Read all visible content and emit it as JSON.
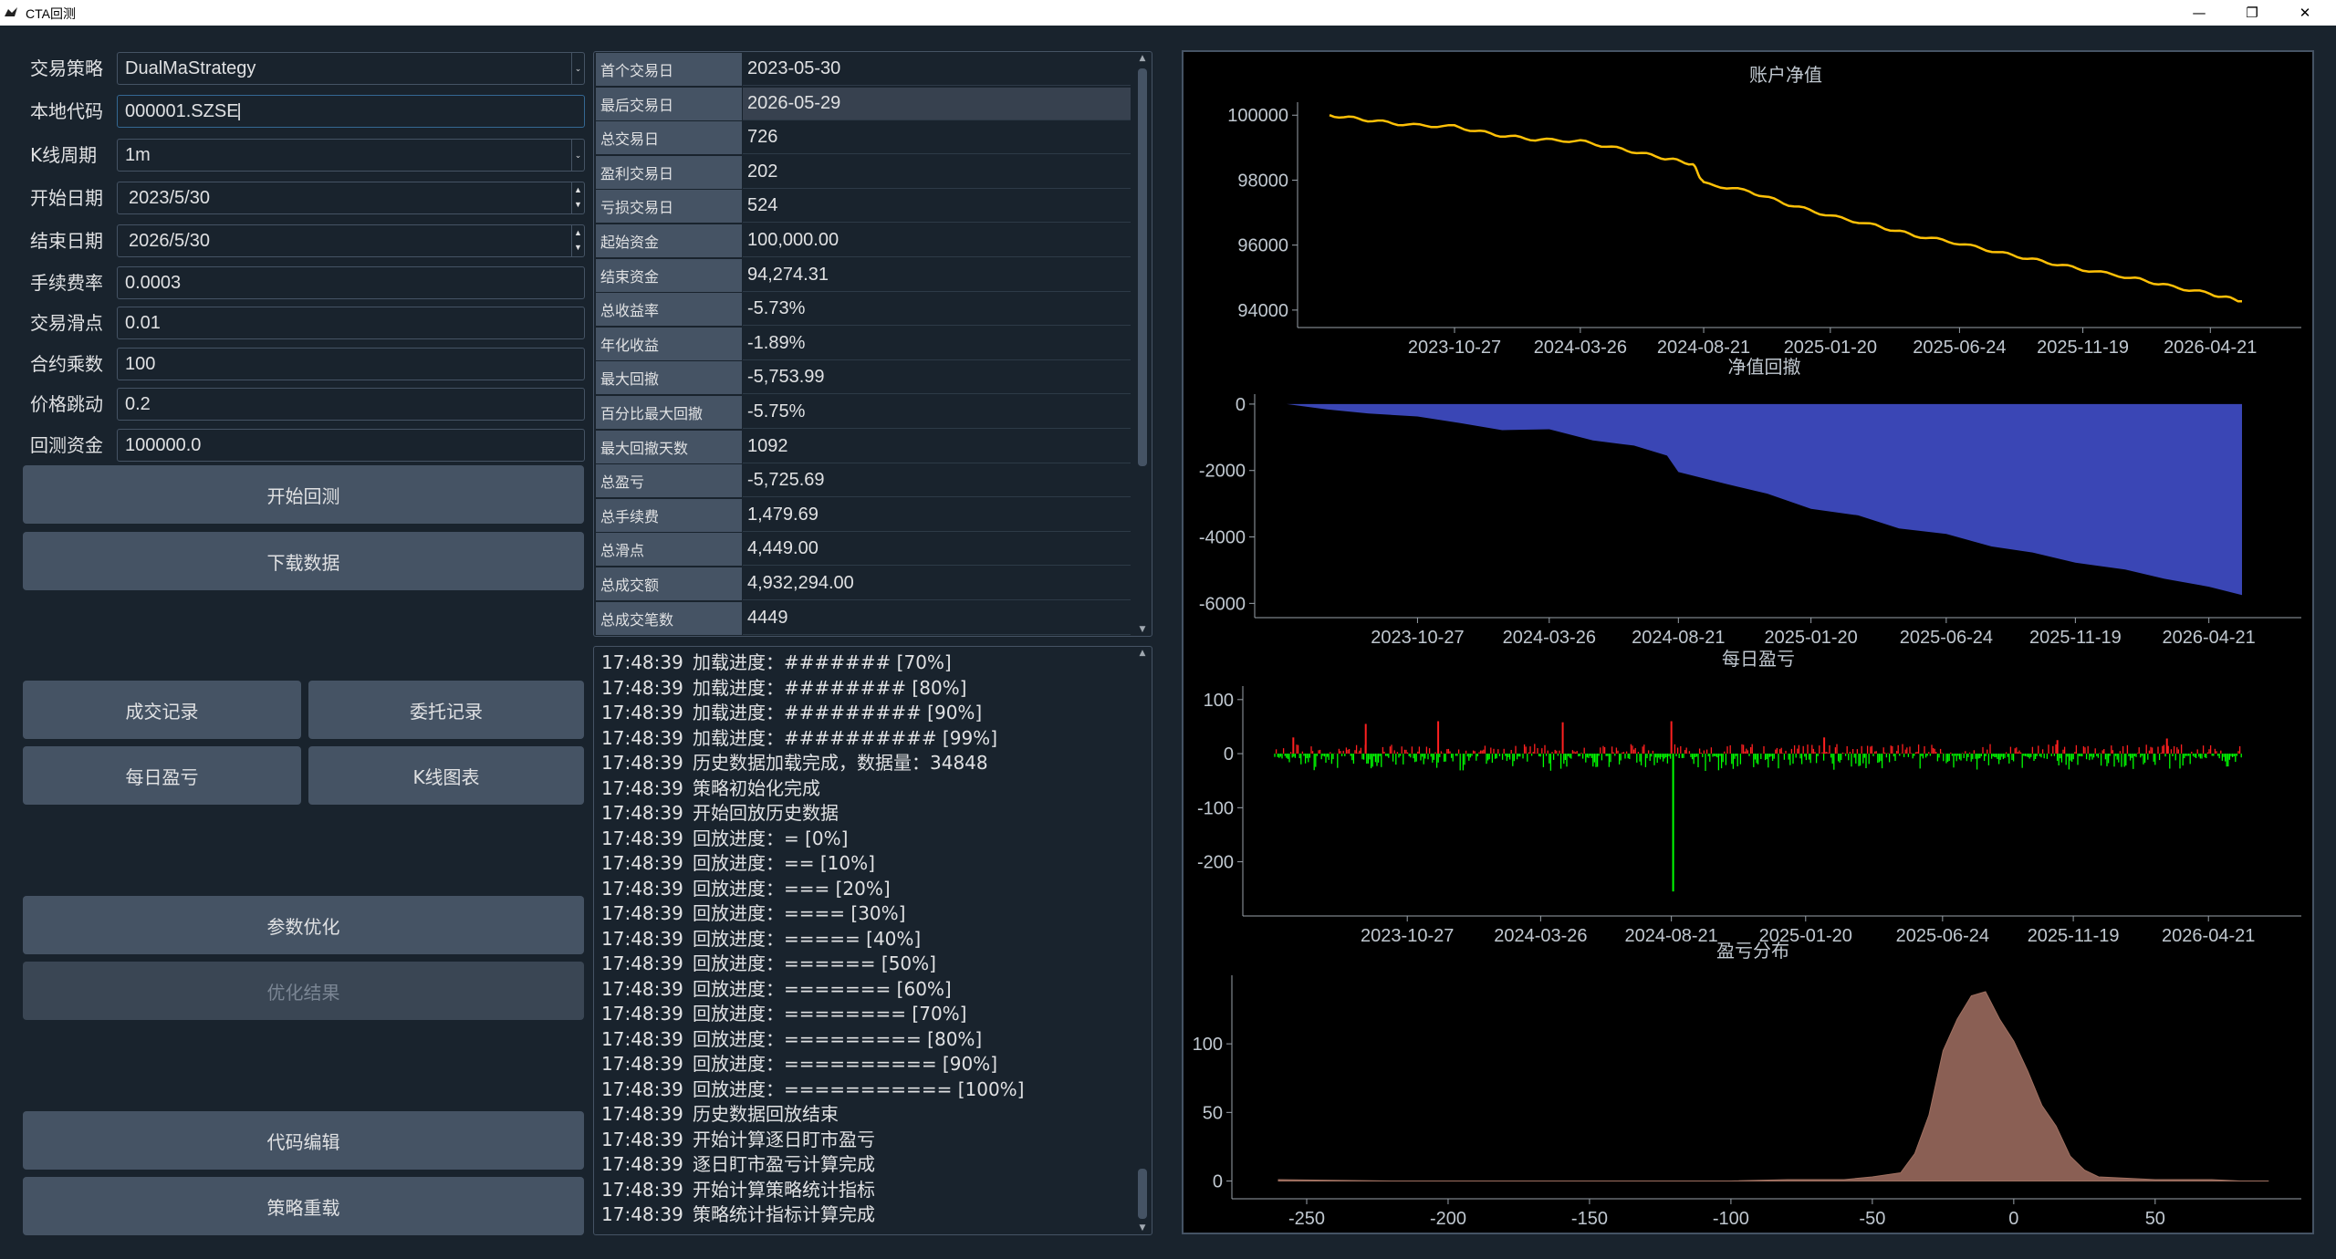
{
  "window": {
    "title": "CTA回测",
    "min": "—",
    "max": "❐",
    "close": "✕"
  },
  "form": [
    {
      "label": "交易策略",
      "value": "DualMaStrategy",
      "kind": "combo"
    },
    {
      "label": "本地代码",
      "value": "000001.SZSE",
      "kind": "text",
      "focus": true
    },
    {
      "label": "K线周期",
      "value": "1m",
      "kind": "combo"
    },
    {
      "label": "开始日期",
      "value": "2023/5/30",
      "kind": "date"
    },
    {
      "label": "结束日期",
      "value": "2026/5/30",
      "kind": "date"
    },
    {
      "label": "手续费率",
      "value": "0.0003",
      "kind": "text"
    },
    {
      "label": "交易滑点",
      "value": "0.01",
      "kind": "text"
    },
    {
      "label": "合约乘数",
      "value": "100",
      "kind": "text"
    },
    {
      "label": "价格跳动",
      "value": "0.2",
      "kind": "text"
    },
    {
      "label": "回测资金",
      "value": "100000.0",
      "kind": "text"
    }
  ],
  "buttons": {
    "start": "开始回测",
    "download": "下载数据",
    "trades": "成交记录",
    "orders": "委托记录",
    "daily": "每日盈亏",
    "kline": "K线图表",
    "optimize": "参数优化",
    "opt_result": "优化结果",
    "edit": "代码编辑",
    "reload": "策略重载"
  },
  "stats": [
    [
      "首个交易日",
      "2023-05-30"
    ],
    [
      "最后交易日",
      "2026-05-29"
    ],
    [
      "总交易日",
      "726"
    ],
    [
      "盈利交易日",
      "202"
    ],
    [
      "亏损交易日",
      "524"
    ],
    [
      "起始资金",
      "100,000.00"
    ],
    [
      "结束资金",
      "94,274.31"
    ],
    [
      "总收益率",
      "-5.73%"
    ],
    [
      "年化收益",
      "-1.89%"
    ],
    [
      "最大回撤",
      "-5,753.99"
    ],
    [
      "百分比最大回撤",
      "-5.75%"
    ],
    [
      "最大回撤天数",
      "1092"
    ],
    [
      "总盈亏",
      "-5,725.69"
    ],
    [
      "总手续费",
      "1,479.69"
    ],
    [
      "总滑点",
      "4,449.00"
    ],
    [
      "总成交额",
      "4,932,294.00"
    ],
    [
      "总成交笔数",
      "4449"
    ]
  ],
  "log": [
    [
      "17:48:39",
      "加载进度：####### [70%]"
    ],
    [
      "17:48:39",
      "加载进度：######## [80%]"
    ],
    [
      "17:48:39",
      "加载进度：######### [90%]"
    ],
    [
      "17:48:39",
      "加载进度：########## [99%]"
    ],
    [
      "17:48:39",
      "历史数据加载完成，数据量：34848"
    ],
    [
      "17:48:39",
      "策略初始化完成"
    ],
    [
      "17:48:39",
      "开始回放历史数据"
    ],
    [
      "17:48:39",
      "回放进度：= [0%]"
    ],
    [
      "17:48:39",
      "回放进度：== [10%]"
    ],
    [
      "17:48:39",
      "回放进度：=== [20%]"
    ],
    [
      "17:48:39",
      "回放进度：==== [30%]"
    ],
    [
      "17:48:39",
      "回放进度：===== [40%]"
    ],
    [
      "17:48:39",
      "回放进度：====== [50%]"
    ],
    [
      "17:48:39",
      "回放进度：======= [60%]"
    ],
    [
      "17:48:39",
      "回放进度：======== [70%]"
    ],
    [
      "17:48:39",
      "回放进度：========= [80%]"
    ],
    [
      "17:48:39",
      "回放进度：========== [90%]"
    ],
    [
      "17:48:39",
      "回放进度：=========== [100%]"
    ],
    [
      "17:48:39",
      "历史数据回放结束"
    ],
    [
      "17:48:39",
      "开始计算逐日盯市盈亏"
    ],
    [
      "17:48:39",
      "逐日盯市盈亏计算完成"
    ],
    [
      "17:48:39",
      "开始计算策略统计指标"
    ],
    [
      "17:48:39",
      "策略统计指标计算完成"
    ]
  ],
  "chart_data": [
    {
      "type": "line",
      "title": "账户净值",
      "color": "#ffc107",
      "x": [
        "2023-05-30",
        "2023-07-15",
        "2023-09-01",
        "2023-10-27",
        "2023-12-15",
        "2024-02-01",
        "2024-03-26",
        "2024-05-15",
        "2024-07-01",
        "2024-08-08",
        "2024-08-21",
        "2024-10-15",
        "2024-12-01",
        "2025-01-20",
        "2025-03-15",
        "2025-05-01",
        "2025-06-24",
        "2025-08-15",
        "2025-10-01",
        "2025-11-19",
        "2026-01-15",
        "2026-03-01",
        "2026-04-21",
        "2026-05-29"
      ],
      "y": [
        100000,
        99850,
        99700,
        99650,
        99400,
        99250,
        99200,
        98950,
        98700,
        98500,
        97900,
        97650,
        97250,
        96900,
        96600,
        96300,
        96050,
        95750,
        95500,
        95250,
        95000,
        94750,
        94500,
        94270
      ],
      "xticks": [
        "2023-10-27",
        "2024-03-26",
        "2024-08-21",
        "2025-01-20",
        "2025-06-24",
        "2025-11-19",
        "2026-04-21"
      ],
      "yticks": [
        94000,
        96000,
        98000,
        100000
      ],
      "ylim": [
        93800,
        100400
      ]
    },
    {
      "type": "area",
      "title": "净值回撤",
      "color": "#3a46b5",
      "x": [
        "2023-05-30",
        "2023-07-15",
        "2023-09-01",
        "2023-10-27",
        "2023-12-15",
        "2024-02-01",
        "2024-03-26",
        "2024-05-15",
        "2024-07-01",
        "2024-08-08",
        "2024-08-21",
        "2024-10-15",
        "2024-12-01",
        "2025-01-20",
        "2025-03-15",
        "2025-05-01",
        "2025-06-24",
        "2025-08-15",
        "2025-10-01",
        "2025-11-19",
        "2026-01-15",
        "2026-03-01",
        "2026-04-21",
        "2026-05-29"
      ],
      "y": [
        0,
        -150,
        -300,
        -350,
        -600,
        -750,
        -800,
        -1050,
        -1300,
        -1500,
        -2100,
        -2350,
        -2750,
        -3100,
        -3400,
        -3700,
        -3950,
        -4250,
        -4500,
        -4750,
        -5000,
        -5250,
        -5500,
        -5754
      ],
      "xticks": [
        "2023-10-27",
        "2024-03-26",
        "2024-08-21",
        "2025-01-20",
        "2025-06-24",
        "2025-11-19",
        "2026-04-21"
      ],
      "yticks": [
        -6000,
        -4000,
        -2000,
        0
      ],
      "ylim": [
        -6100,
        300
      ]
    },
    {
      "type": "bar",
      "title": "每日盈亏",
      "colors": {
        "profit": "#ff2020",
        "loss": "#00ff00"
      },
      "x": [
        "2023-06-20",
        "2023-09-10",
        "2023-12-01",
        "2024-04-20",
        "2024-08-21",
        "2024-08-23",
        "2025-02-10",
        "2025-11-01",
        "2026-03-05"
      ],
      "y": [
        30,
        55,
        60,
        58,
        60,
        -255,
        30,
        25,
        28
      ],
      "typical_range": [
        -30,
        20
      ],
      "xticks": [
        "2023-10-27",
        "2024-03-26",
        "2024-08-21",
        "2025-01-20",
        "2025-06-24",
        "2025-11-19",
        "2026-04-21"
      ],
      "yticks": [
        -200,
        -100,
        0,
        100
      ],
      "ylim": [
        -280,
        125
      ]
    },
    {
      "type": "area",
      "title": "盈亏分布",
      "color": "#8a5f54",
      "x": [
        -260,
        -220,
        -180,
        -140,
        -100,
        -80,
        -60,
        -50,
        -40,
        -35,
        -30,
        -25,
        -20,
        -15,
        -10,
        -5,
        0,
        5,
        10,
        15,
        20,
        25,
        30,
        40,
        50,
        60,
        70,
        80,
        90
      ],
      "y": [
        1,
        0,
        0,
        0,
        0,
        1,
        1,
        3,
        6,
        20,
        48,
        95,
        118,
        135,
        138,
        118,
        102,
        80,
        55,
        40,
        18,
        8,
        3,
        2,
        1,
        1,
        1,
        0,
        0
      ],
      "xticks": [
        -250,
        -200,
        -150,
        -100,
        -50,
        0,
        50
      ],
      "yticks": [
        0,
        50,
        100
      ],
      "xlim": [
        -270,
        92
      ],
      "ylim": [
        -5,
        150
      ]
    }
  ]
}
